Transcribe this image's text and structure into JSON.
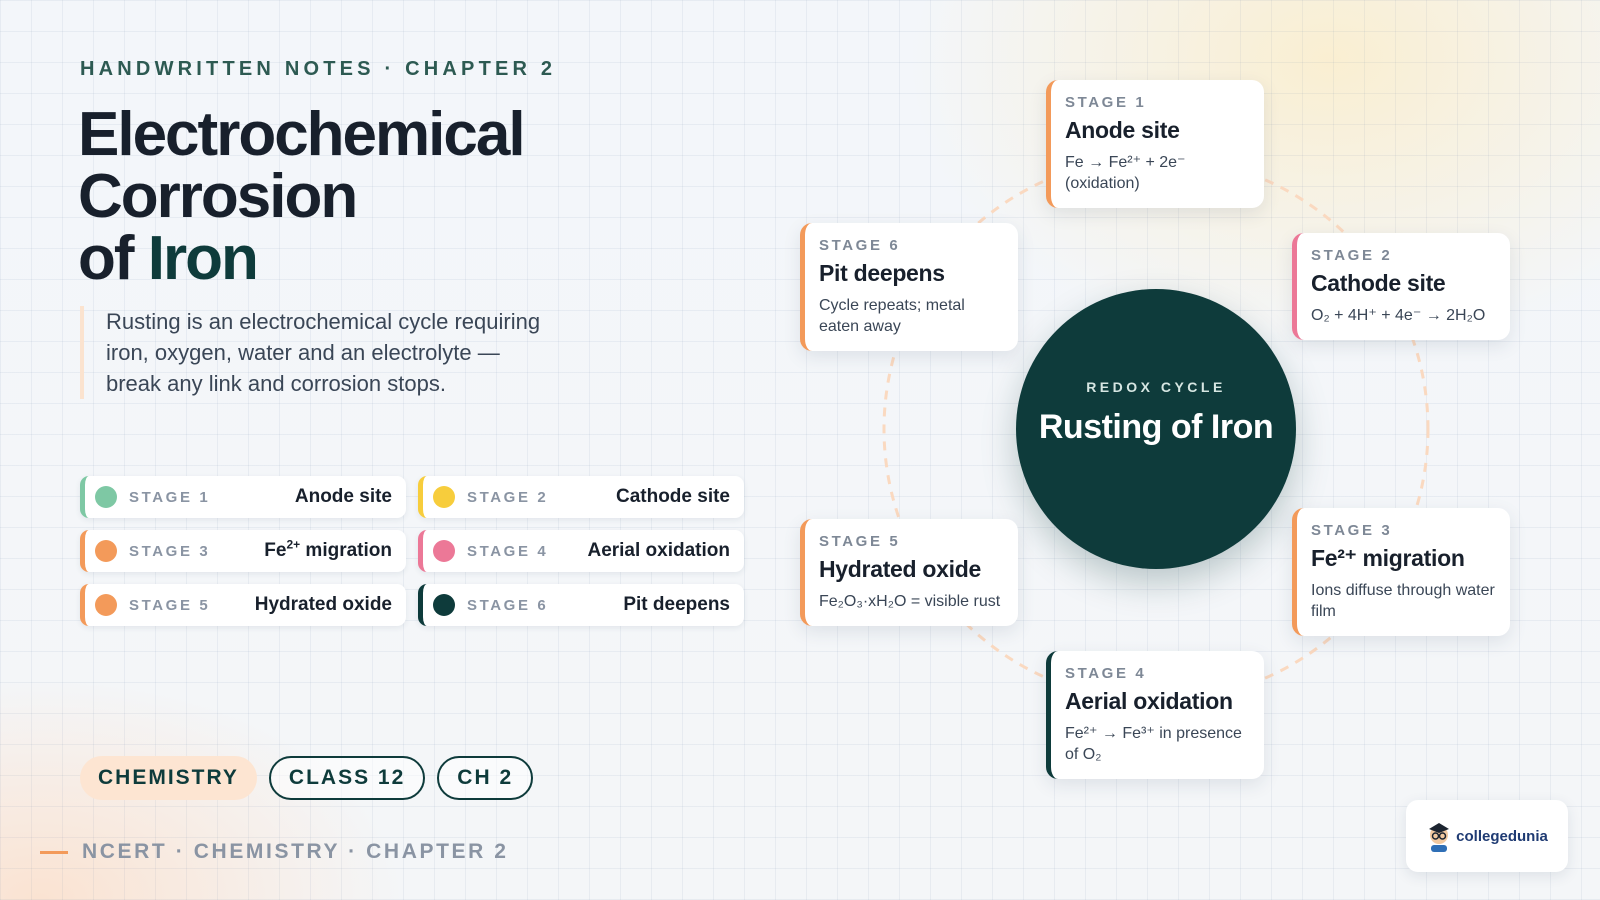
{
  "header": {
    "eyebrow": "HANDWRITTEN NOTES · CHAPTER 2",
    "title_line1": "Electrochemical",
    "title_line2": "Corrosion",
    "title_line3_prefix": "of ",
    "title_line3_highlight": "Iron"
  },
  "lead": "Rusting is an electrochemical cycle requiring iron, oxygen, water and an electrolyte — break any link and corrosion stops.",
  "stage_chips": [
    {
      "stage": "STAGE 1",
      "name": "Anode site",
      "color": "#7ec8a4"
    },
    {
      "stage": "STAGE 2",
      "name": "Cathode site",
      "color": "#f7cd3c"
    },
    {
      "stage": "STAGE 3",
      "name": "Fe migration",
      "name_sup": "2+",
      "color": "#f39a5a"
    },
    {
      "stage": "STAGE 4",
      "name": "Aerial oxidation",
      "color": "#ec7897"
    },
    {
      "stage": "STAGE 5",
      "name": "Hydrated oxide",
      "color": "#f39a5a"
    },
    {
      "stage": "STAGE 6",
      "name": "Pit deepens",
      "color": "#0e3b3b"
    }
  ],
  "tags": [
    "CHEMISTRY",
    "CLASS 12",
    "CH 2"
  ],
  "footer": "NCERT · CHEMISTRY · CHAPTER 2",
  "hub": {
    "kicker": "REDOX CYCLE",
    "title": "Rusting of Iron"
  },
  "cycle_cards": [
    {
      "stage": "STAGE 1",
      "title": "Anode site",
      "desc": "Fe → Fe²⁺ + 2e⁻ (oxidation)",
      "accent": "#f39a5a"
    },
    {
      "stage": "STAGE 2",
      "title": "Cathode site",
      "desc": "O₂ + 4H⁺ + 4e⁻ → 2H₂O",
      "accent": "#ec7897"
    },
    {
      "stage": "STAGE 3",
      "title": "Fe²⁺ migration",
      "desc": "Ions diffuse through water film",
      "accent": "#f39a5a"
    },
    {
      "stage": "STAGE 4",
      "title": "Aerial oxidation",
      "desc": "Fe²⁺ → Fe³⁺ in presence of O₂",
      "accent": "#0e3b3b"
    },
    {
      "stage": "STAGE 5",
      "title": "Hydrated oxide",
      "desc": "Fe₂O₃·xH₂O = visible rust",
      "accent": "#f39a5a"
    },
    {
      "stage": "STAGE 6",
      "title": "Pit deepens",
      "desc": "Cycle repeats; metal eaten away",
      "accent": "#f39a5a"
    }
  ],
  "logo": {
    "text": "collegedunia",
    "icon": "student-avatar-icon"
  },
  "colors": {
    "primary": "#0e3b3b",
    "accent_orange": "#f39a5a",
    "accent_pink": "#ec7897",
    "accent_yellow": "#f7cd3c",
    "accent_green": "#7ec8a4"
  }
}
